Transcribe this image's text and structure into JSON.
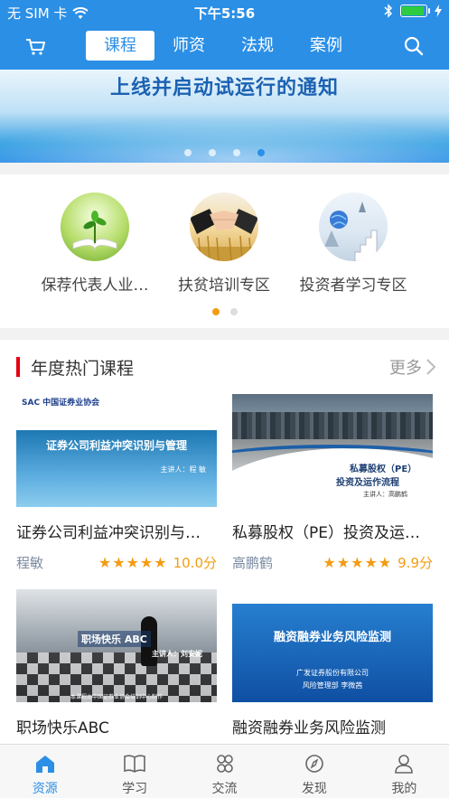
{
  "status_bar": {
    "carrier": "无 SIM 卡",
    "time": "下午5:56",
    "battery_level": 0.95
  },
  "nav": {
    "cart_icon": "cart-icon",
    "search_icon": "search-icon",
    "tabs": [
      "课程",
      "师资",
      "法规",
      "案例"
    ],
    "active_tab": 0
  },
  "banner": {
    "headline": "上线并启动试运行的通知",
    "page_count": 4,
    "current_page": 3
  },
  "categories": {
    "items": [
      {
        "label": "保荐代表人业…",
        "icon": "book-plant-icon"
      },
      {
        "label": "扶贫培训专区",
        "icon": "handshake-icon"
      },
      {
        "label": "投资者学习专区",
        "icon": "stairs-globe-icon"
      }
    ],
    "page_count": 2,
    "current_page": 0
  },
  "hot_courses": {
    "title": "年度热门课程",
    "more_label": "更多",
    "courses": [
      {
        "title": "证券公司利益冲突识别与…",
        "author": "程敏",
        "stars": 5,
        "score": "10.0分",
        "thumb_logo": "SAC 中国证券业协会",
        "thumb_title": "证券公司利益冲突识别与管理",
        "thumb_speaker": "主讲人：程 敏"
      },
      {
        "title": "私募股权（PE）投资及运…",
        "author": "高鹏鹤",
        "stars": 5,
        "score": "9.9分",
        "thumb_title_1": "私募股权（PE）",
        "thumb_title_2": "投资及运作流程",
        "thumb_speaker": "主讲人：高鹏鹤"
      },
      {
        "title": "职场快乐ABC",
        "thumb_title": "职场快乐 ABC",
        "thumb_speaker": "主讲人：刘安妮",
        "thumb_footer": "本课程由中国证券业协会培训中心制作"
      },
      {
        "title": "融资融券业务风险监测",
        "thumb_title": "融资融券业务风险监测",
        "thumb_line1": "广发证券股份有限公司",
        "thumb_line2": "风险管理部  李微茜"
      }
    ]
  },
  "tabbar": {
    "items": [
      {
        "label": "资源",
        "icon": "home-icon"
      },
      {
        "label": "学习",
        "icon": "open-book-icon"
      },
      {
        "label": "交流",
        "icon": "four-circles-icon"
      },
      {
        "label": "发现",
        "icon": "compass-icon"
      },
      {
        "label": "我的",
        "icon": "person-icon"
      }
    ],
    "active": 0
  },
  "colors": {
    "brand_blue": "#2b8fe6",
    "accent_orange": "#f39c12",
    "section_red": "#e60012"
  }
}
